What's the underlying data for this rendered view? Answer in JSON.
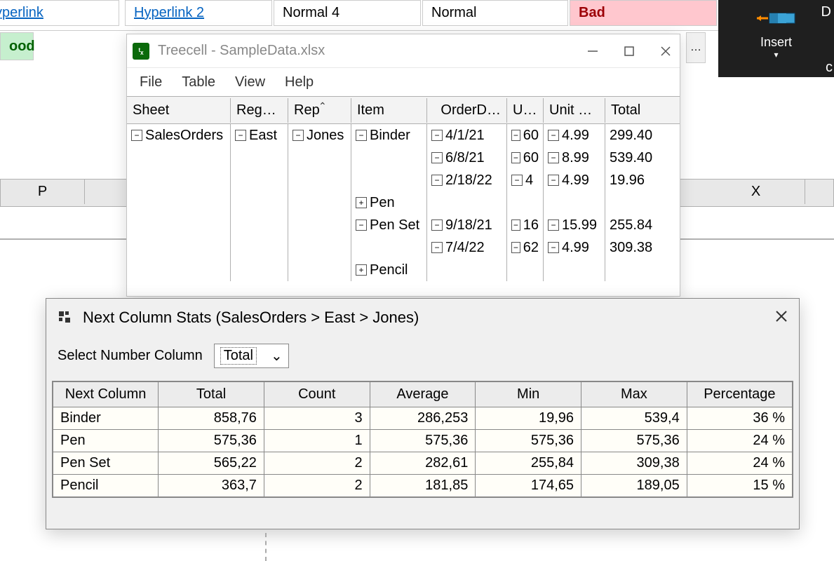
{
  "excel": {
    "styles": {
      "hyperlink": "Hyperlink",
      "hyperlink2": "Hyperlink 2",
      "normal4": "Normal 4",
      "normal": "Normal",
      "bad": "Bad",
      "good": "ood"
    },
    "insert_label": "Insert",
    "d_right": "D",
    "col_P": "P",
    "col_X": "X",
    "c_label": "c"
  },
  "treecell": {
    "title": "Treecell - SampleData.xlsx",
    "menu": {
      "file": "File",
      "table": "Table",
      "view": "View",
      "help": "Help"
    },
    "headers": {
      "sheet": "Sheet",
      "region": "Reg…",
      "rep": "Rep",
      "item": "Item",
      "orderdate": "OrderD…",
      "units": "U…",
      "unitcost": "Unit …",
      "total": "Total"
    },
    "sheet_val": "SalesOrders",
    "region_val": "East",
    "rep_val": "Jones",
    "items": {
      "binder": "Binder",
      "pen": "Pen",
      "penset": "Pen Set",
      "pencil": "Pencil"
    },
    "rows": [
      {
        "date": "4/1/21",
        "units": "60",
        "unitcost": "4.99",
        "total": "299.40"
      },
      {
        "date": "6/8/21",
        "units": "60",
        "unitcost": "8.99",
        "total": "539.40"
      },
      {
        "date": "2/18/22",
        "units": "4",
        "unitcost": "4.99",
        "total": "19.96"
      },
      {
        "date": "9/18/21",
        "units": "16",
        "unitcost": "15.99",
        "total": "255.84"
      },
      {
        "date": "7/4/22",
        "units": "62",
        "unitcost": "4.99",
        "total": "309.38"
      }
    ]
  },
  "stats": {
    "title": "Next Column Stats (SalesOrders > East > Jones)",
    "select_label": "Select Number Column",
    "select_value": "Total",
    "headers": {
      "nextcol": "Next Column",
      "total": "Total",
      "count": "Count",
      "average": "Average",
      "min": "Min",
      "max": "Max",
      "percentage": "Percentage"
    },
    "rows": [
      {
        "name": "Binder",
        "total": "858,76",
        "count": "3",
        "average": "286,253",
        "min": "19,96",
        "max": "539,4",
        "percentage": "36 %"
      },
      {
        "name": "Pen",
        "total": "575,36",
        "count": "1",
        "average": "575,36",
        "min": "575,36",
        "max": "575,36",
        "percentage": "24 %"
      },
      {
        "name": "Pen Set",
        "total": "565,22",
        "count": "2",
        "average": "282,61",
        "min": "255,84",
        "max": "309,38",
        "percentage": "24 %"
      },
      {
        "name": "Pencil",
        "total": "363,7",
        "count": "2",
        "average": "181,85",
        "min": "174,65",
        "max": "189,05",
        "percentage": "15 %"
      }
    ]
  }
}
